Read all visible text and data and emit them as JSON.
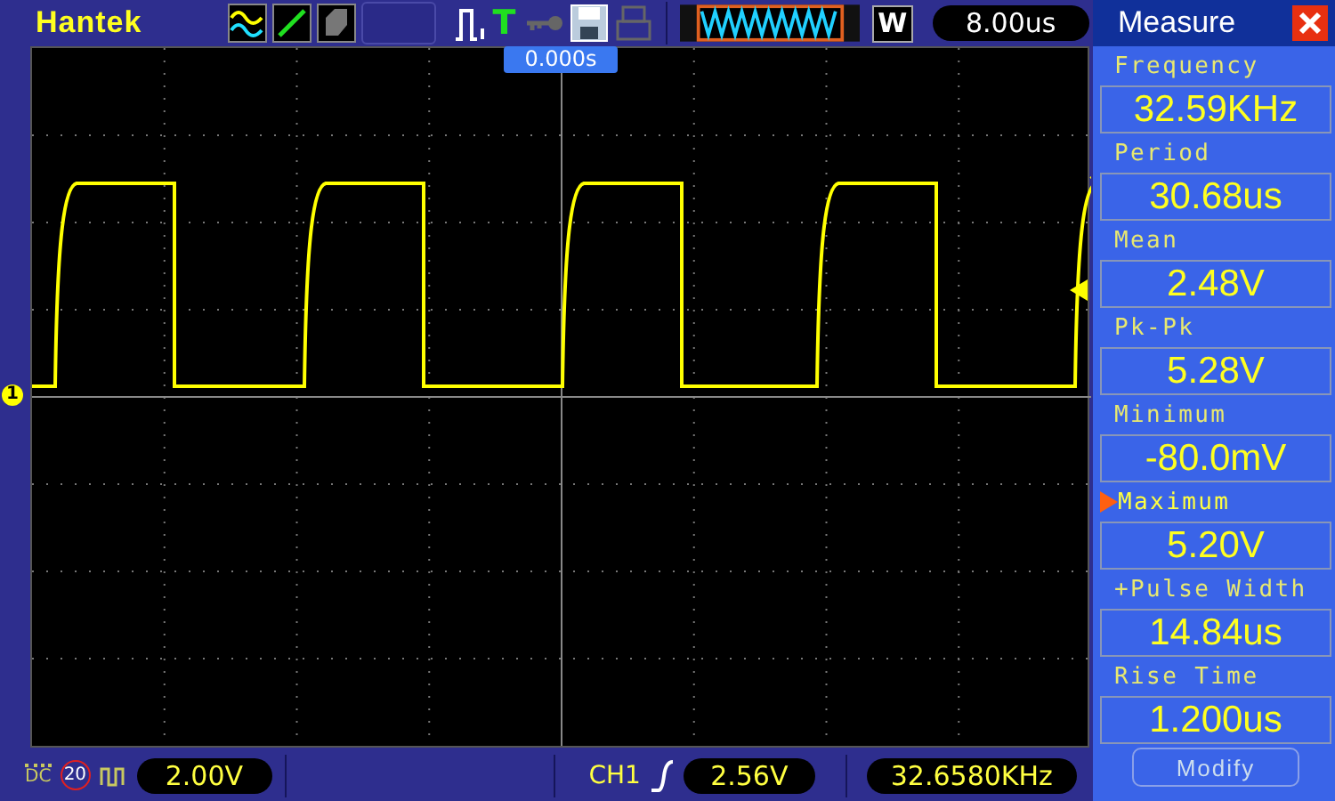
{
  "header": {
    "brand": "Hantek",
    "trigger_label": "T",
    "zoom_label": "W",
    "timebase": "8.00us",
    "time_position": "0.000s"
  },
  "display": {
    "channel_marker": "1"
  },
  "status_bar": {
    "coupling": "DC",
    "bandwidth_limit": "20",
    "volts_per_div": "2.00V",
    "trigger_source": "CH1",
    "trigger_level": "2.56V",
    "frequency": "32.6580KHz"
  },
  "measure_panel": {
    "title": "Measure",
    "items": [
      {
        "label": "Frequency",
        "value": "32.59KHz",
        "selected": false
      },
      {
        "label": "Period",
        "value": "30.68us",
        "selected": false
      },
      {
        "label": "Mean",
        "value": "2.48V",
        "selected": false
      },
      {
        "label": "Pk-Pk",
        "value": "5.28V",
        "selected": false
      },
      {
        "label": "Minimum",
        "value": "-80.0mV",
        "selected": false
      },
      {
        "label": "Maximum",
        "value": "5.20V",
        "selected": true
      },
      {
        "label": "+Pulse Width",
        "value": "14.84us",
        "selected": false
      },
      {
        "label": "Rise Time",
        "value": "1.200us",
        "selected": false
      }
    ],
    "button": "Modify"
  }
}
